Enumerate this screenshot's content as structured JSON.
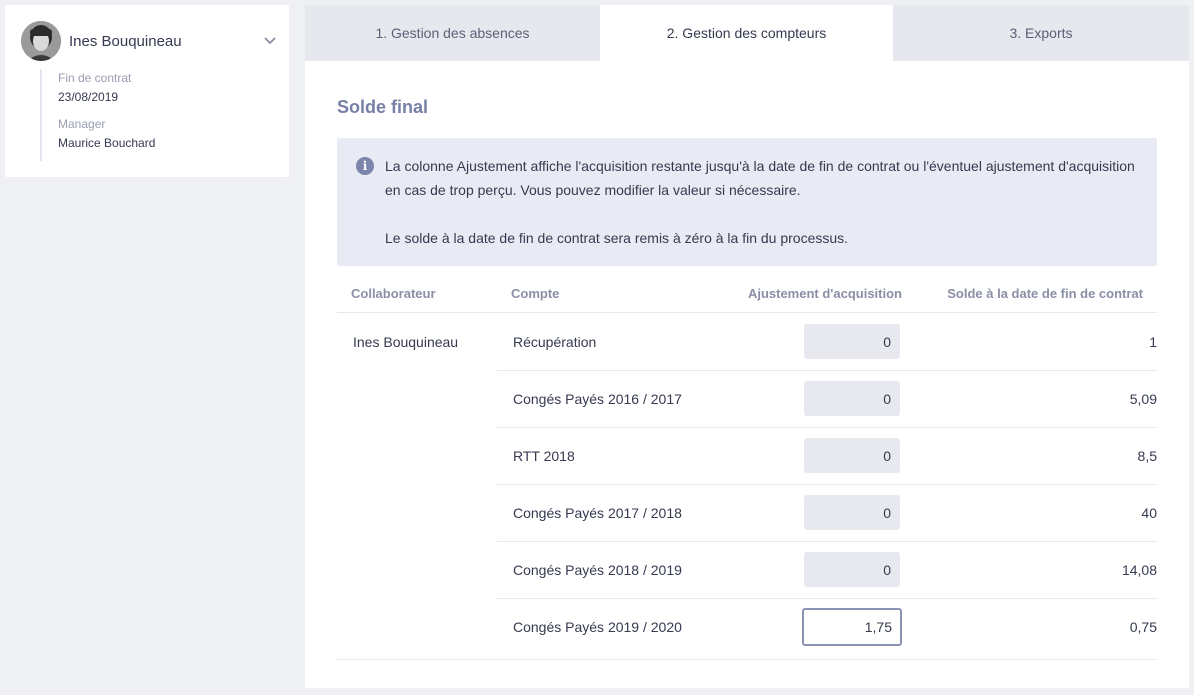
{
  "profile": {
    "name": "Ines Bouquineau",
    "details": [
      {
        "label": "Fin de contrat",
        "value": "23/08/2019"
      },
      {
        "label": "Manager",
        "value": "Maurice Bouchard"
      }
    ]
  },
  "tabs": [
    {
      "label": "1. Gestion des absences",
      "active": false
    },
    {
      "label": "2. Gestion des compteurs",
      "active": true
    },
    {
      "label": "3. Exports",
      "active": false
    }
  ],
  "section": {
    "title": "Solde final",
    "info_icon": "info-icon",
    "info_paragraphs": [
      "La colonne Ajustement affiche l'acquisition restante jusqu'à la date de fin de contrat ou l'éventuel ajustement d'acquisition en cas de trop perçu. Vous pouvez modifier la valeur si nécessaire.",
      "Le solde à la date de fin de contrat sera remis à zéro à la fin du processus."
    ]
  },
  "table": {
    "headers": {
      "collaborateur": "Collaborateur",
      "compte": "Compte",
      "ajustement": "Ajustement d'acquisition",
      "solde": "Solde à la date de fin de contrat"
    },
    "collaborateur": "Ines Bouquineau",
    "rows": [
      {
        "compte": "Récupération",
        "ajustement": "0",
        "solde": "1"
      },
      {
        "compte": "Congés Payés 2016 / 2017",
        "ajustement": "0",
        "solde": "5,09"
      },
      {
        "compte": "RTT 2018",
        "ajustement": "0",
        "solde": "8,5"
      },
      {
        "compte": "Congés Payés 2017 / 2018",
        "ajustement": "0",
        "solde": "40"
      },
      {
        "compte": "Congés Payés 2018 / 2019",
        "ajustement": "0",
        "solde": "14,08"
      },
      {
        "compte": "Congés Payés 2019 / 2020",
        "ajustement": "1,75",
        "solde": "0,75",
        "focused": true
      }
    ]
  },
  "colors": {
    "accent": "#7680a7",
    "info_bg": "#e8ebf4",
    "page_bg": "#eff0f4"
  }
}
